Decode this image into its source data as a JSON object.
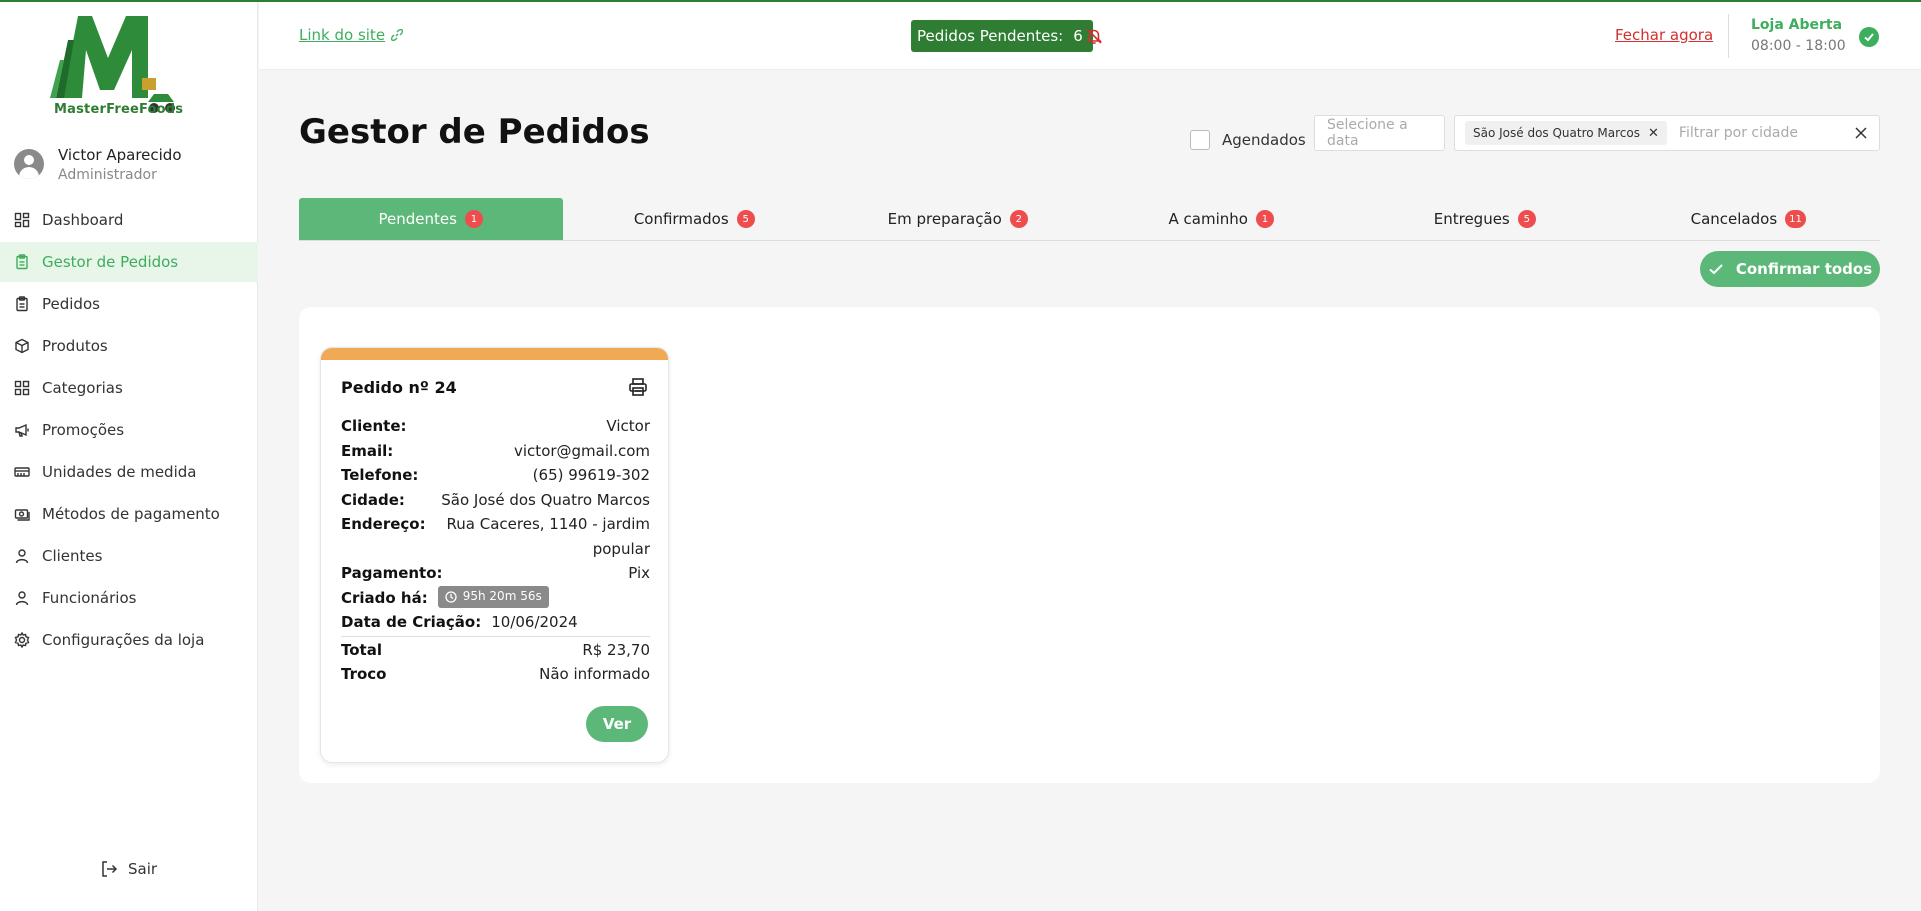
{
  "brand": {
    "name": "MasterFreeFoods"
  },
  "user": {
    "name": "Victor Aparecido",
    "role": "Administrador"
  },
  "sidebar": {
    "items": [
      {
        "label": "Dashboard",
        "icon": "dashboard-icon"
      },
      {
        "label": "Gestor de Pedidos",
        "icon": "clipboard-icon",
        "active": true
      },
      {
        "label": "Pedidos",
        "icon": "clipboard-icon"
      },
      {
        "label": "Produtos",
        "icon": "box-icon"
      },
      {
        "label": "Categorias",
        "icon": "grid-icon"
      },
      {
        "label": "Promoções",
        "icon": "megaphone-icon"
      },
      {
        "label": "Unidades de medida",
        "icon": "ruler-icon"
      },
      {
        "label": "Métodos de pagamento",
        "icon": "cash-icon"
      },
      {
        "label": "Clientes",
        "icon": "user-icon"
      },
      {
        "label": "Funcionários",
        "icon": "user-icon"
      },
      {
        "label": "Configurações da loja",
        "icon": "gear-icon"
      }
    ],
    "logout_label": "Sair"
  },
  "topbar": {
    "site_link": "Link do site",
    "pending_label": "Pedidos Pendentes:",
    "pending_count": "6",
    "close_now": "Fechar agora",
    "store_status": "Loja Aberta",
    "store_hours": "08:00 - 18:00"
  },
  "page": {
    "title": "Gestor de Pedidos",
    "scheduled_label": "Agendados",
    "date_placeholder": "Selecione a data",
    "city_chip": "São José dos Quatro Marcos",
    "city_placeholder": "Filtrar por cidade",
    "confirm_all": "Confirmar todos"
  },
  "tabs": [
    {
      "label": "Pendentes",
      "count": "1",
      "active": true
    },
    {
      "label": "Confirmados",
      "count": "5"
    },
    {
      "label": "Em preparação",
      "count": "2"
    },
    {
      "label": "A caminho",
      "count": "1"
    },
    {
      "label": "Entregues",
      "count": "5"
    },
    {
      "label": "Cancelados",
      "count": "11"
    }
  ],
  "order": {
    "title": "Pedido nº 24",
    "client_label": "Cliente:",
    "client": "Victor",
    "email_label": "Email:",
    "email": "victor@gmail.com",
    "phone_label": "Telefone:",
    "phone": "(65) 99619-302",
    "city_label": "Cidade:",
    "city": "São José dos Quatro Marcos",
    "address_label": "Endereço:",
    "address": "Rua Caceres, 1140 - jardim popular",
    "payment_label": "Pagamento:",
    "payment": "Pix",
    "created_ago_label": "Criado há:",
    "created_ago": "95h 20m 56s",
    "created_date_label": "Data de Criação:",
    "created_date": "10/06/2024",
    "total_label": "Total",
    "total": "R$ 23,70",
    "change_label": "Troco",
    "change": "Não informado",
    "view_button": "Ver"
  },
  "colors": {
    "primary": "#5cb878",
    "dark_green": "#2e7d32",
    "badge_red": "#ee4d4d",
    "card_band": "#f0a955",
    "danger": "#d32f2f"
  }
}
